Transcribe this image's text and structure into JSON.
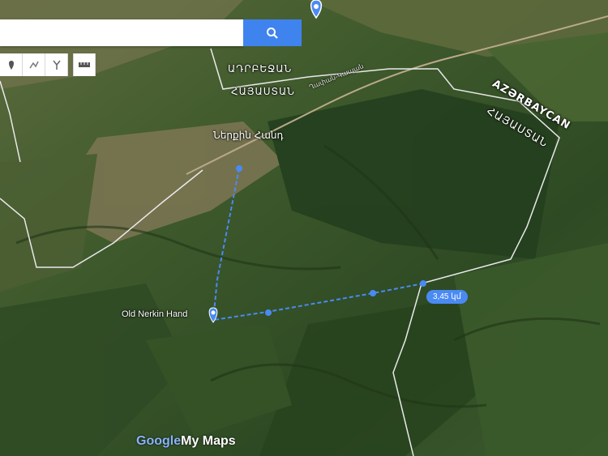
{
  "search": {
    "placeholder": "",
    "button_icon": "search-icon",
    "accent": "#3f83ee"
  },
  "toolbar": {
    "icons": [
      "marker-icon",
      "draw-line-icon",
      "route-icon",
      "ruler-icon"
    ]
  },
  "labels": {
    "armenia_region_top_line1": "ԱԴՐԲԵՋԱՆ",
    "armenia_region_top_line2": "ՀԱՅԱՍՏԱՆ",
    "azerbaycan": "AZƏRBAYCAN",
    "hayastan_right": "ՀԱՅԱՍՏԱՆ",
    "village": "Ներքին Հանդ",
    "old_place": "Old Nerkin Hand",
    "road_label": "Ղափան-Կապան"
  },
  "measure": {
    "value": "3,45 կմ"
  },
  "branding": {
    "logo_word": "Google",
    "product": "My Maps"
  },
  "colors": {
    "route": "#4a8af4",
    "border": "#e9e9e9",
    "pin": "#4a8af4"
  }
}
